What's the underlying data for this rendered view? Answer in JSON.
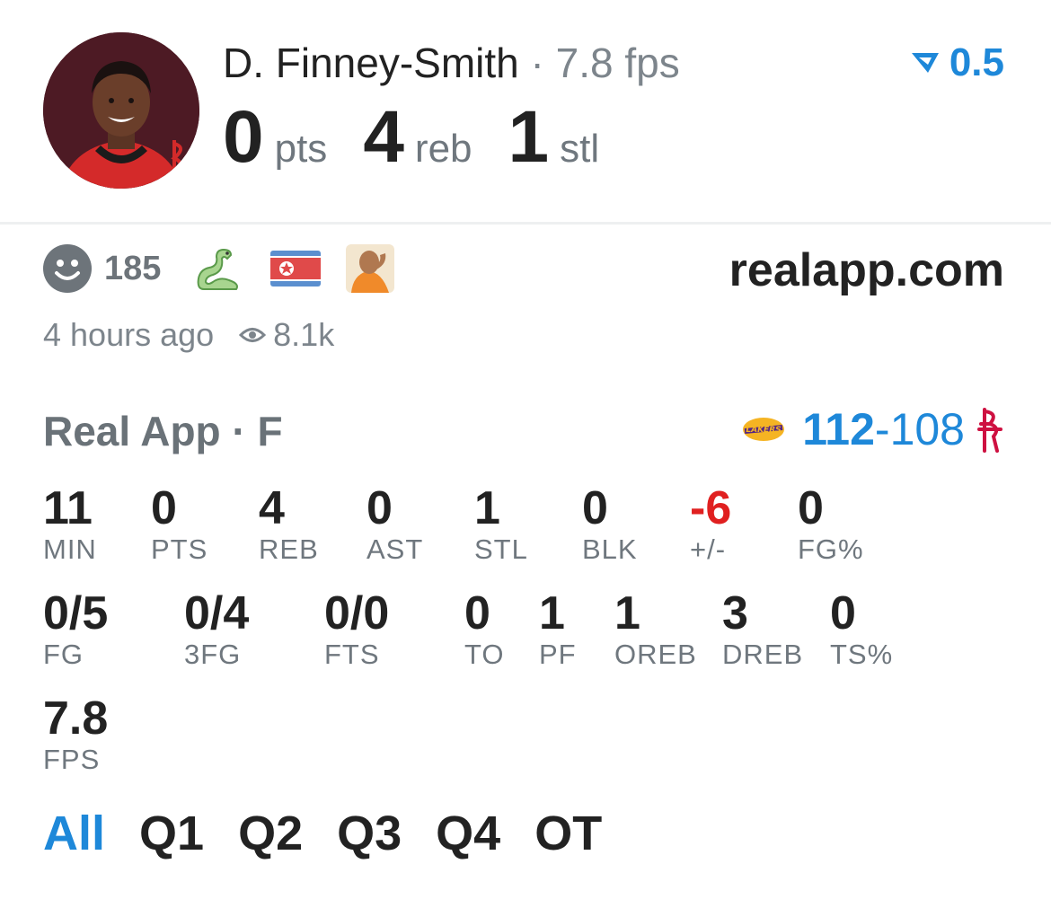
{
  "player": {
    "name": "D. Finney-Smith",
    "separator": "·",
    "fps_text": "7.8 fps"
  },
  "badge": {
    "icon": "real-chevron-icon",
    "value": "0.5",
    "color": "#1e88d9"
  },
  "headline": [
    {
      "value": "0",
      "unit": "pts"
    },
    {
      "value": "4",
      "unit": "reb"
    },
    {
      "value": "1",
      "unit": "stl"
    }
  ],
  "reactions": {
    "icon": "smiley-icon",
    "count": "185",
    "emojis": [
      "snake-emoji",
      "north-korea-flag-emoji",
      "drake-meme-emoji"
    ]
  },
  "site": "realapp.com",
  "post": {
    "time": "4 hours ago",
    "views": "8.1k",
    "views_icon": "eye-icon"
  },
  "game": {
    "source": "Real App · F",
    "away_logo": "lakers-logo",
    "home_logo": "rockets-logo",
    "score_away": "112",
    "score_dash": "-",
    "score_home": "108"
  },
  "stats": {
    "row1": [
      {
        "value": "11",
        "label": "MIN"
      },
      {
        "value": "0",
        "label": "PTS"
      },
      {
        "value": "4",
        "label": "REB"
      },
      {
        "value": "0",
        "label": "AST"
      },
      {
        "value": "1",
        "label": "STL"
      },
      {
        "value": "0",
        "label": "BLK"
      },
      {
        "value": "-6",
        "label": "+/-"
      },
      {
        "value": "0",
        "label": "FG%"
      }
    ],
    "row2": [
      {
        "value": "0/5",
        "label": "FG"
      },
      {
        "value": "0/4",
        "label": "3FG"
      },
      {
        "value": "0/0",
        "label": "FTS"
      },
      {
        "value": "0",
        "label": "TO"
      },
      {
        "value": "1",
        "label": "PF"
      },
      {
        "value": "1",
        "label": "OREB"
      },
      {
        "value": "3",
        "label": "DREB"
      },
      {
        "value": "0",
        "label": "TS%"
      }
    ],
    "row3": [
      {
        "value": "7.8",
        "label": "FPS"
      }
    ]
  },
  "tabs": [
    "All",
    "Q1",
    "Q2",
    "Q3",
    "Q4",
    "OT"
  ],
  "colors": {
    "accent": "#1e88d9",
    "negative": "#e02020",
    "muted": "#6f777e"
  }
}
